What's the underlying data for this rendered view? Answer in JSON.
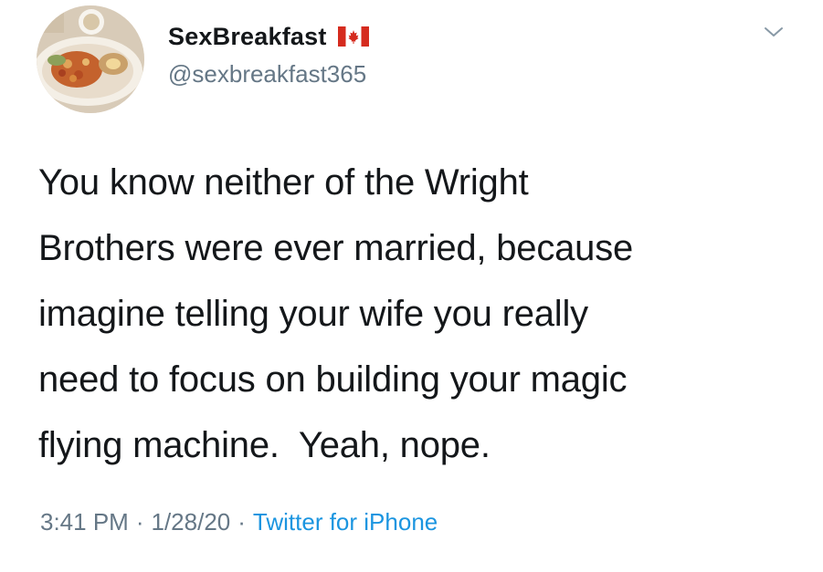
{
  "tweet": {
    "display_name": "SexBreakfast",
    "handle": "@sexbreakfast365",
    "text": "You know neither of the Wright\nBrothers were ever married, because\nimagine telling your wife you really\nneed to focus on building your magic\nflying machine.  Yeah, nope.",
    "time": "3:41 PM",
    "date": "1/28/20",
    "separator": "·",
    "source": "Twitter for iPhone",
    "flag_icon": "canada-flag-icon",
    "avatar_icon": "breakfast-plate-avatar",
    "more_icon": "chevron-down-icon"
  },
  "colors": {
    "text": "#14171a",
    "secondary": "#657786",
    "link": "#1b95e0",
    "flag_red": "#d52b1e"
  }
}
